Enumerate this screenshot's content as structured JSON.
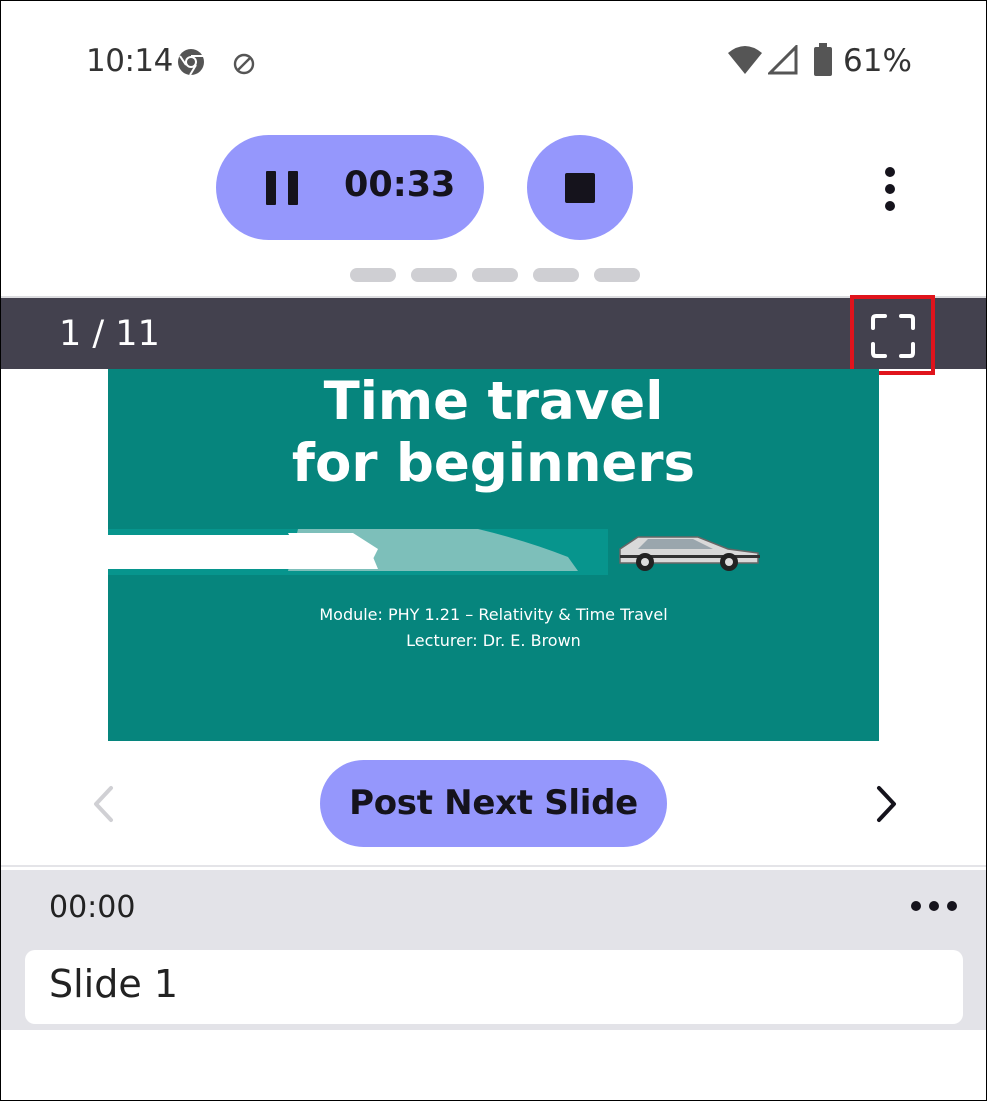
{
  "status_bar": {
    "time": "10:14",
    "battery_percent": "61%",
    "icons": [
      "chrome-icon",
      "sync-off-icon",
      "wifi-icon",
      "signal-icon",
      "battery-icon"
    ]
  },
  "recording": {
    "timer": "00:33",
    "pause_icon": "pause-icon",
    "stop_icon": "stop-icon",
    "more_icon": "more-vert-icon"
  },
  "page_indicator": {
    "count": 5
  },
  "slide_header": {
    "counter": "1 / 11",
    "fullscreen_icon": "fullscreen-icon"
  },
  "slide": {
    "title_line1": "Time travel",
    "title_line2": "for beginners",
    "subtitle_line1": "Module: PHY 1.21 – Relativity & Time Travel",
    "subtitle_line2": "Lecturer: Dr. E. Brown",
    "colors": {
      "background": "#06857d",
      "text": "#ffffff"
    }
  },
  "navigation": {
    "post_button": "Post Next Slide",
    "prev_icon": "chevron-left-icon",
    "next_icon": "chevron-right-icon"
  },
  "notes": {
    "timestamp": "00:00",
    "more_icon": "more-horiz-icon",
    "label": "Slide 1"
  },
  "colors": {
    "accent": "#9597fc",
    "header_bar": "#43414e",
    "highlight_box": "#e0141c"
  }
}
